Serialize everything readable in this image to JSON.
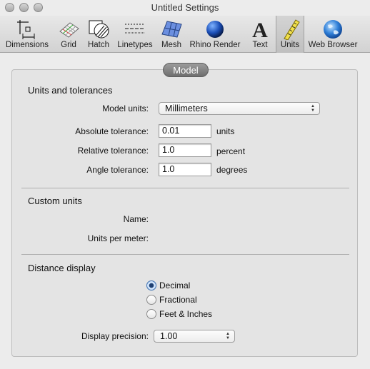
{
  "window": {
    "title": "Untitled Settings"
  },
  "toolbar": {
    "items": [
      {
        "label": "Dimensions"
      },
      {
        "label": "Grid"
      },
      {
        "label": "Hatch"
      },
      {
        "label": "Linetypes"
      },
      {
        "label": "Mesh"
      },
      {
        "label": "Rhino Render"
      },
      {
        "label": "Text"
      },
      {
        "label": "Units"
      },
      {
        "label": "Web Browser"
      }
    ],
    "selected": "Units"
  },
  "tab": {
    "label": "Model"
  },
  "units_tolerances": {
    "title": "Units and tolerances",
    "model_units_label": "Model units:",
    "model_units_value": "Millimeters",
    "absolute_label": "Absolute tolerance:",
    "absolute_value": "0.01",
    "absolute_unit": "units",
    "relative_label": "Relative tolerance:",
    "relative_value": "1.0",
    "relative_unit": "percent",
    "angle_label": "Angle tolerance:",
    "angle_value": "1.0",
    "angle_unit": "degrees"
  },
  "custom_units": {
    "title": "Custom units",
    "name_label": "Name:",
    "upm_label": "Units per meter:"
  },
  "distance_display": {
    "title": "Distance display",
    "options": [
      "Decimal",
      "Fractional",
      "Feet & Inches"
    ],
    "selected": "Decimal",
    "precision_label": "Display precision:",
    "precision_value": "1.00"
  }
}
